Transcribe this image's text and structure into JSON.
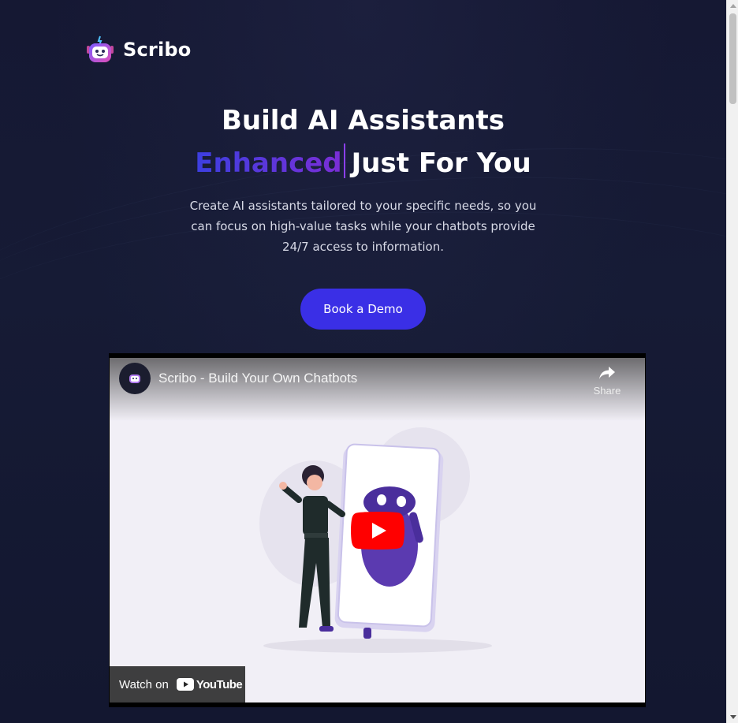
{
  "brand": {
    "name": "Scribo",
    "logo_icon": "robot-head-icon"
  },
  "hero": {
    "title_line1": "Build AI Assistants",
    "title_accent": "Enhanced",
    "title_rest": "Just For You",
    "subtitle": "Create AI assistants tailored to your specific needs, so you can focus on high-value tasks while your chatbots provide 24/7 access to information.",
    "cta_label": "Book a Demo"
  },
  "video": {
    "title": "Scribo - Build Your Own Chatbots",
    "share_label": "Share",
    "watch_on_label": "Watch on",
    "youtube_label": "YouTube",
    "play_icon": "play-button-icon"
  },
  "colors": {
    "accent": "#3a2fe6",
    "accent_gradient_end": "#7b2ed6",
    "background": "#161a33",
    "youtube_red": "#ff0000"
  }
}
